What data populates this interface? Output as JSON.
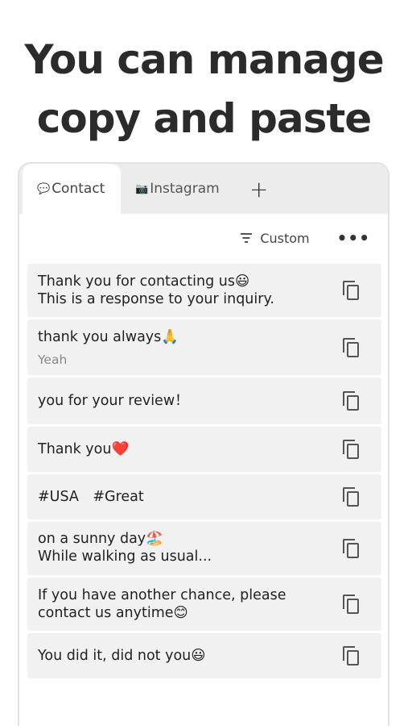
{
  "headline": {
    "line1": "You can manage",
    "line2": "copy and paste"
  },
  "tabs": [
    {
      "icon": "💬",
      "label": "Contact",
      "active": true
    },
    {
      "icon": "📷",
      "label": "Instagram",
      "active": false
    }
  ],
  "add_tab_label": "+",
  "toolbar": {
    "sort_label": "Custom",
    "more_label": "•••"
  },
  "items": [
    {
      "line1": "Thank you for contacting us😃",
      "line2": "This is a response to your inquiry.",
      "sub": ""
    },
    {
      "line1": "thank you always🙏",
      "line2": "",
      "sub": "Yeah"
    },
    {
      "line1": " you for your review！",
      "line2": "",
      "sub": ""
    },
    {
      "line1": "Thank you❤️",
      "line2": "",
      "sub": ""
    },
    {
      "line1": "#USA　#Great",
      "line2": "",
      "sub": ""
    },
    {
      "line1": "on a sunny day🏖️",
      "line2": "While walking as usual...",
      "sub": ""
    },
    {
      "line1": "If you have another chance, please",
      "line2": "contact us anytime😊",
      "sub": ""
    },
    {
      "line1": "You did it, did not you😃",
      "line2": "",
      "sub": ""
    }
  ]
}
